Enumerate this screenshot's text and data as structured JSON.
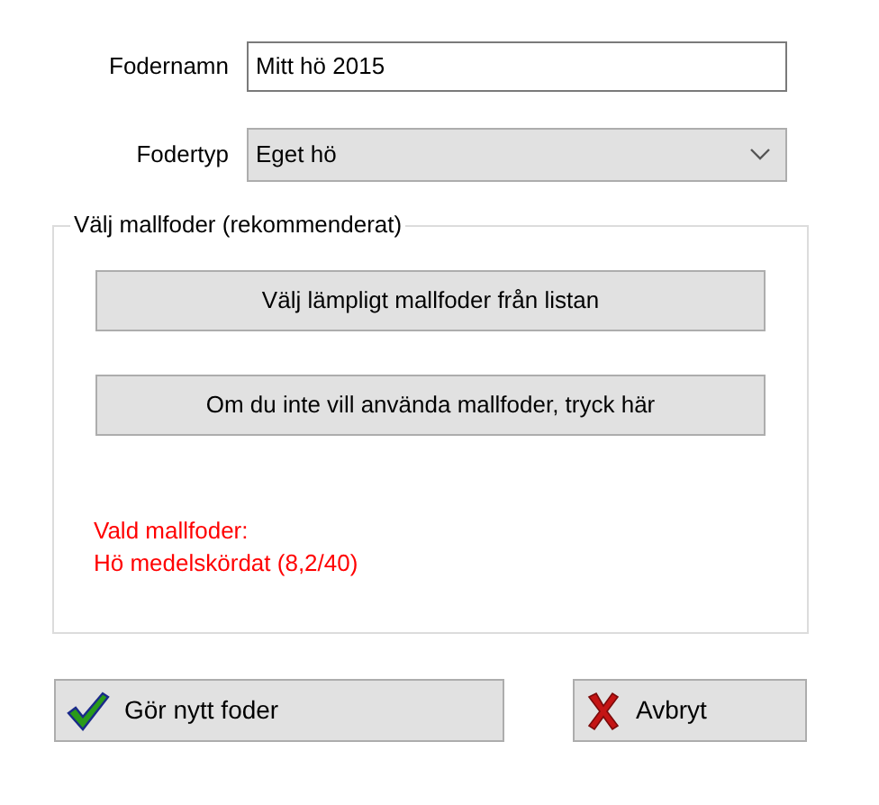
{
  "name_field": {
    "label": "Fodernamn",
    "value": "Mitt hö 2015"
  },
  "type_select": {
    "label": "Fodertyp",
    "value": "Eget hö"
  },
  "template_group": {
    "title": "Välj mallfoder (rekommenderat)",
    "buttons": [
      "Välj lämpligt mallfoder från listan",
      "Om du inte vill använda mallfoder, tryck här"
    ],
    "selected_caption": "Vald mallfoder:",
    "selected_value": "Hö medelskördat (8,2/40)"
  },
  "actions": [
    {
      "kind": "confirm",
      "label": "Gör nytt foder"
    },
    {
      "kind": "cancel",
      "label": "Avbryt"
    }
  ]
}
